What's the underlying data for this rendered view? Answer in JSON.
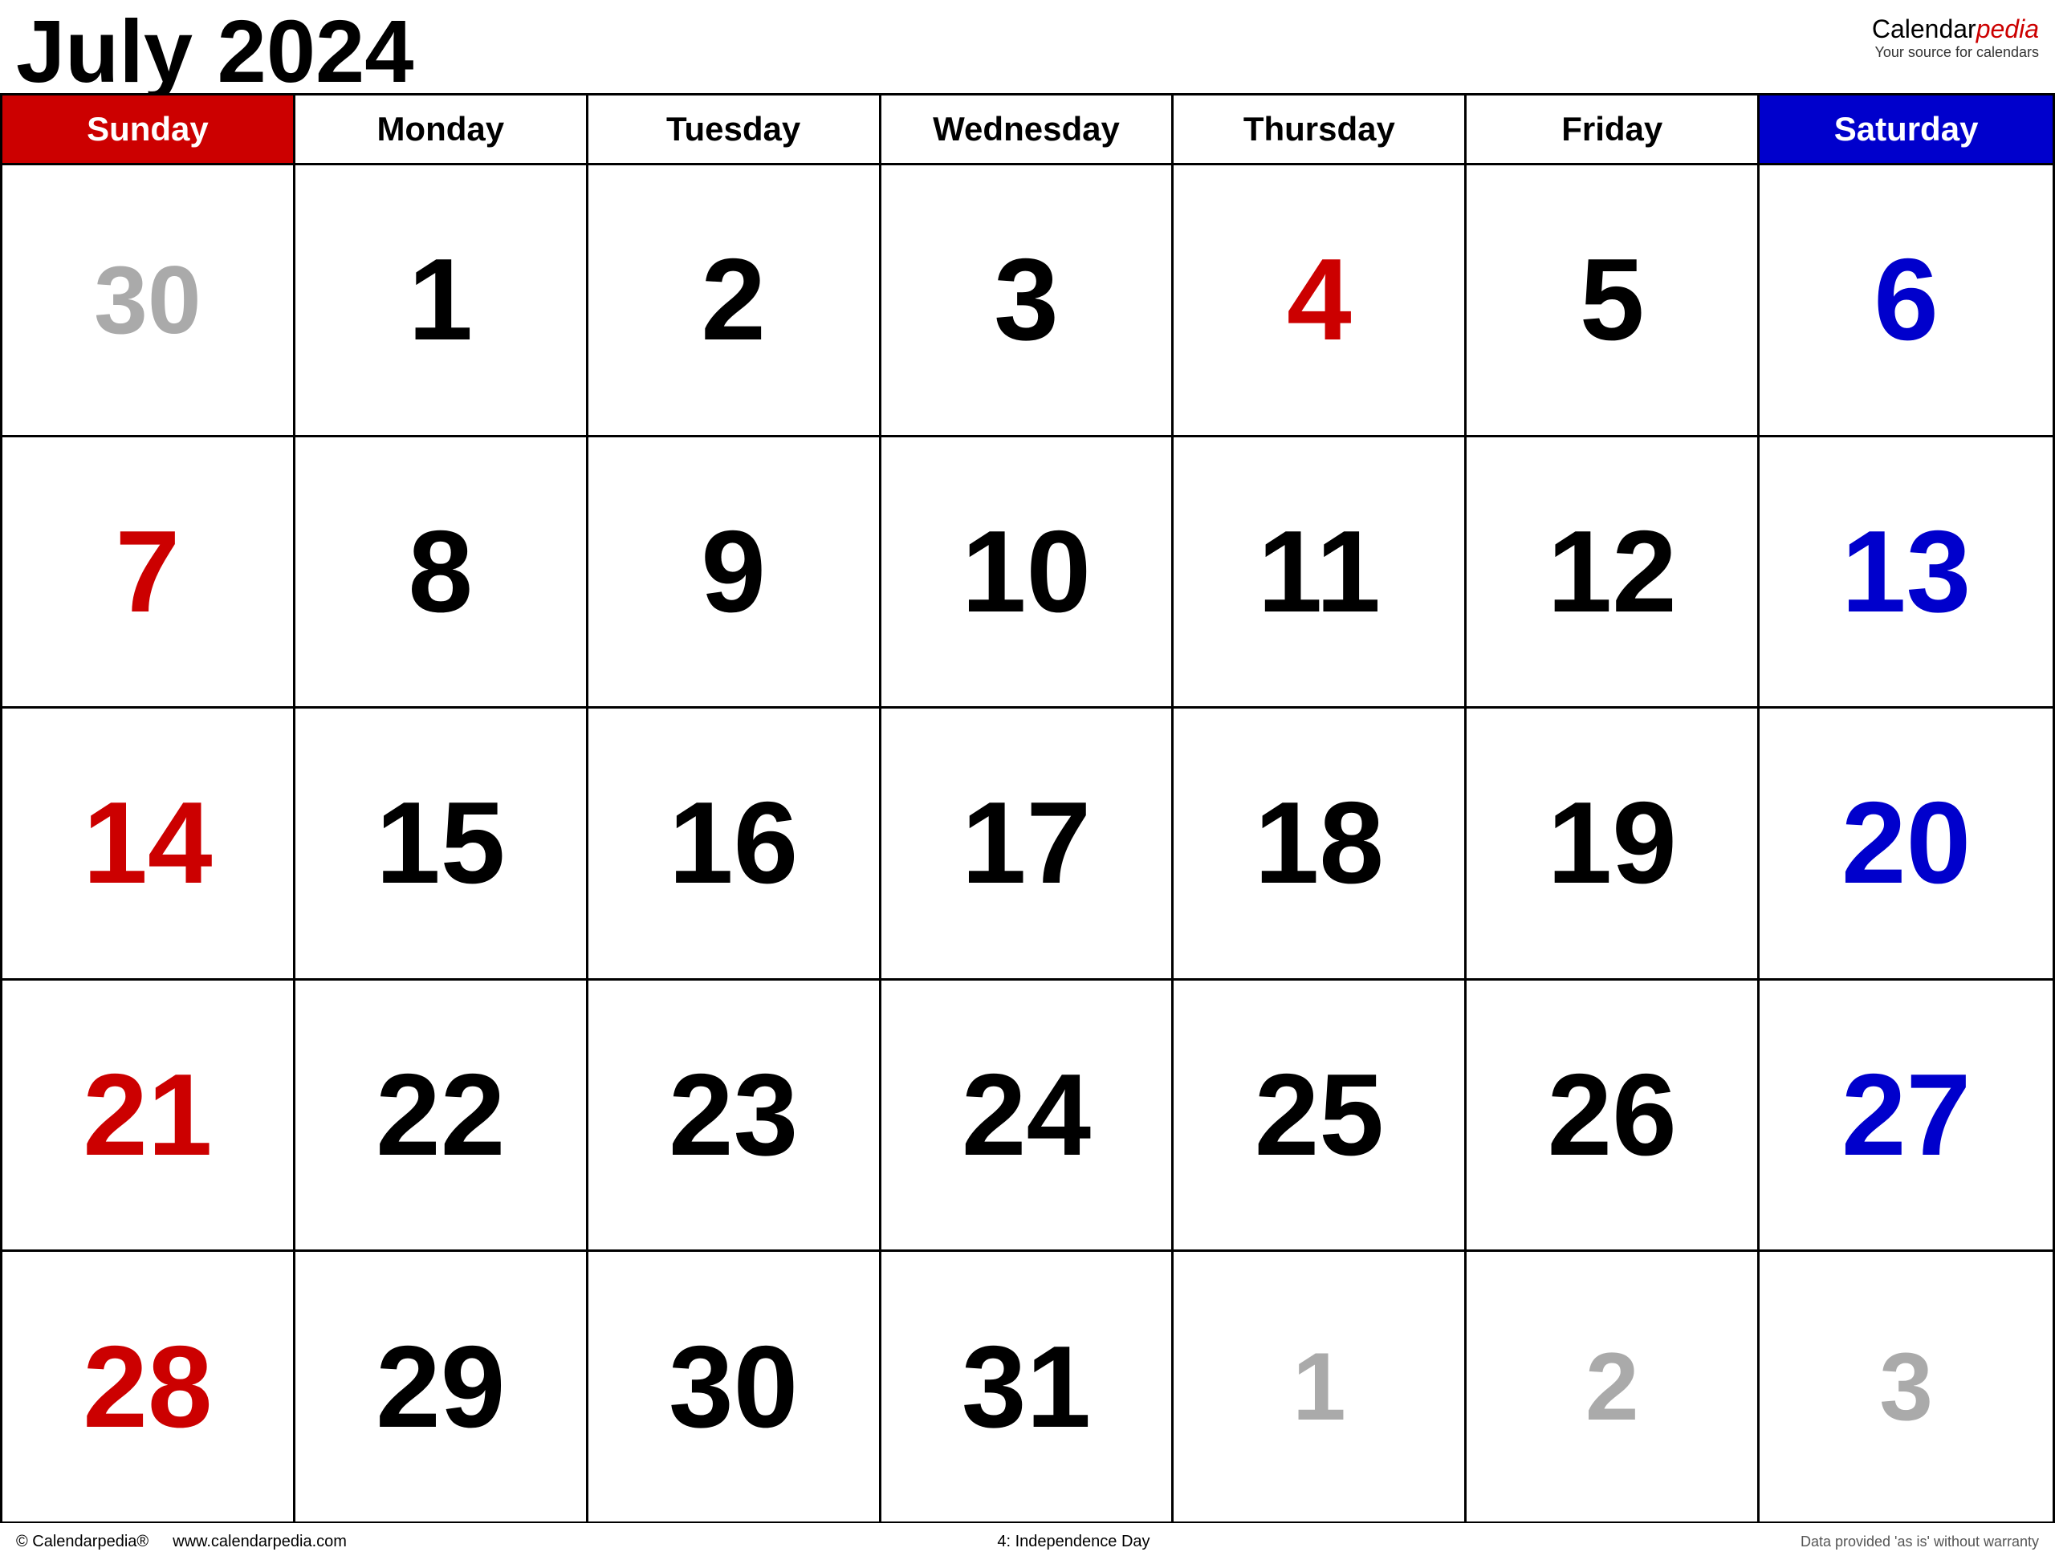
{
  "header": {
    "title": "July 2024",
    "brand_name": "Calendar",
    "brand_name_emphasis": "pedia",
    "brand_tagline": "Your source for calendars"
  },
  "colors": {
    "sunday_bg": "#cc0000",
    "saturday_bg": "#0000cc",
    "sunday_text": "#cc0000",
    "saturday_text": "#0000cc",
    "holiday_text": "#cc0000",
    "muted_text": "#aaaaaa",
    "black_text": "#000000",
    "white_text": "#ffffff"
  },
  "day_headers": [
    {
      "label": "Sunday",
      "type": "sunday"
    },
    {
      "label": "Monday",
      "type": "weekday"
    },
    {
      "label": "Tuesday",
      "type": "weekday"
    },
    {
      "label": "Wednesday",
      "type": "weekday"
    },
    {
      "label": "Thursday",
      "type": "weekday"
    },
    {
      "label": "Friday",
      "type": "weekday"
    },
    {
      "label": "Saturday",
      "type": "saturday"
    }
  ],
  "weeks": [
    {
      "days": [
        {
          "number": "30",
          "type": "muted"
        },
        {
          "number": "1",
          "type": "weekday"
        },
        {
          "number": "2",
          "type": "weekday"
        },
        {
          "number": "3",
          "type": "weekday"
        },
        {
          "number": "4",
          "type": "holiday"
        },
        {
          "number": "5",
          "type": "weekday"
        },
        {
          "number": "6",
          "type": "saturday"
        }
      ]
    },
    {
      "days": [
        {
          "number": "7",
          "type": "sunday"
        },
        {
          "number": "8",
          "type": "weekday"
        },
        {
          "number": "9",
          "type": "weekday"
        },
        {
          "number": "10",
          "type": "weekday"
        },
        {
          "number": "11",
          "type": "weekday"
        },
        {
          "number": "12",
          "type": "weekday"
        },
        {
          "number": "13",
          "type": "saturday"
        }
      ]
    },
    {
      "days": [
        {
          "number": "14",
          "type": "sunday"
        },
        {
          "number": "15",
          "type": "weekday"
        },
        {
          "number": "16",
          "type": "weekday"
        },
        {
          "number": "17",
          "type": "weekday"
        },
        {
          "number": "18",
          "type": "weekday"
        },
        {
          "number": "19",
          "type": "weekday"
        },
        {
          "number": "20",
          "type": "saturday"
        }
      ]
    },
    {
      "days": [
        {
          "number": "21",
          "type": "sunday"
        },
        {
          "number": "22",
          "type": "weekday"
        },
        {
          "number": "23",
          "type": "weekday"
        },
        {
          "number": "24",
          "type": "weekday"
        },
        {
          "number": "25",
          "type": "weekday"
        },
        {
          "number": "26",
          "type": "weekday"
        },
        {
          "number": "27",
          "type": "saturday"
        }
      ]
    },
    {
      "days": [
        {
          "number": "28",
          "type": "sunday"
        },
        {
          "number": "29",
          "type": "weekday"
        },
        {
          "number": "30",
          "type": "weekday"
        },
        {
          "number": "31",
          "type": "weekday"
        },
        {
          "number": "1",
          "type": "muted"
        },
        {
          "number": "2",
          "type": "muted"
        },
        {
          "number": "3",
          "type": "muted"
        }
      ]
    }
  ],
  "footer": {
    "copyright": "© Calendarpedia®",
    "website": "www.calendarpedia.com",
    "holiday_note": "4: Independence Day",
    "disclaimer": "Data provided 'as is' without warranty"
  }
}
